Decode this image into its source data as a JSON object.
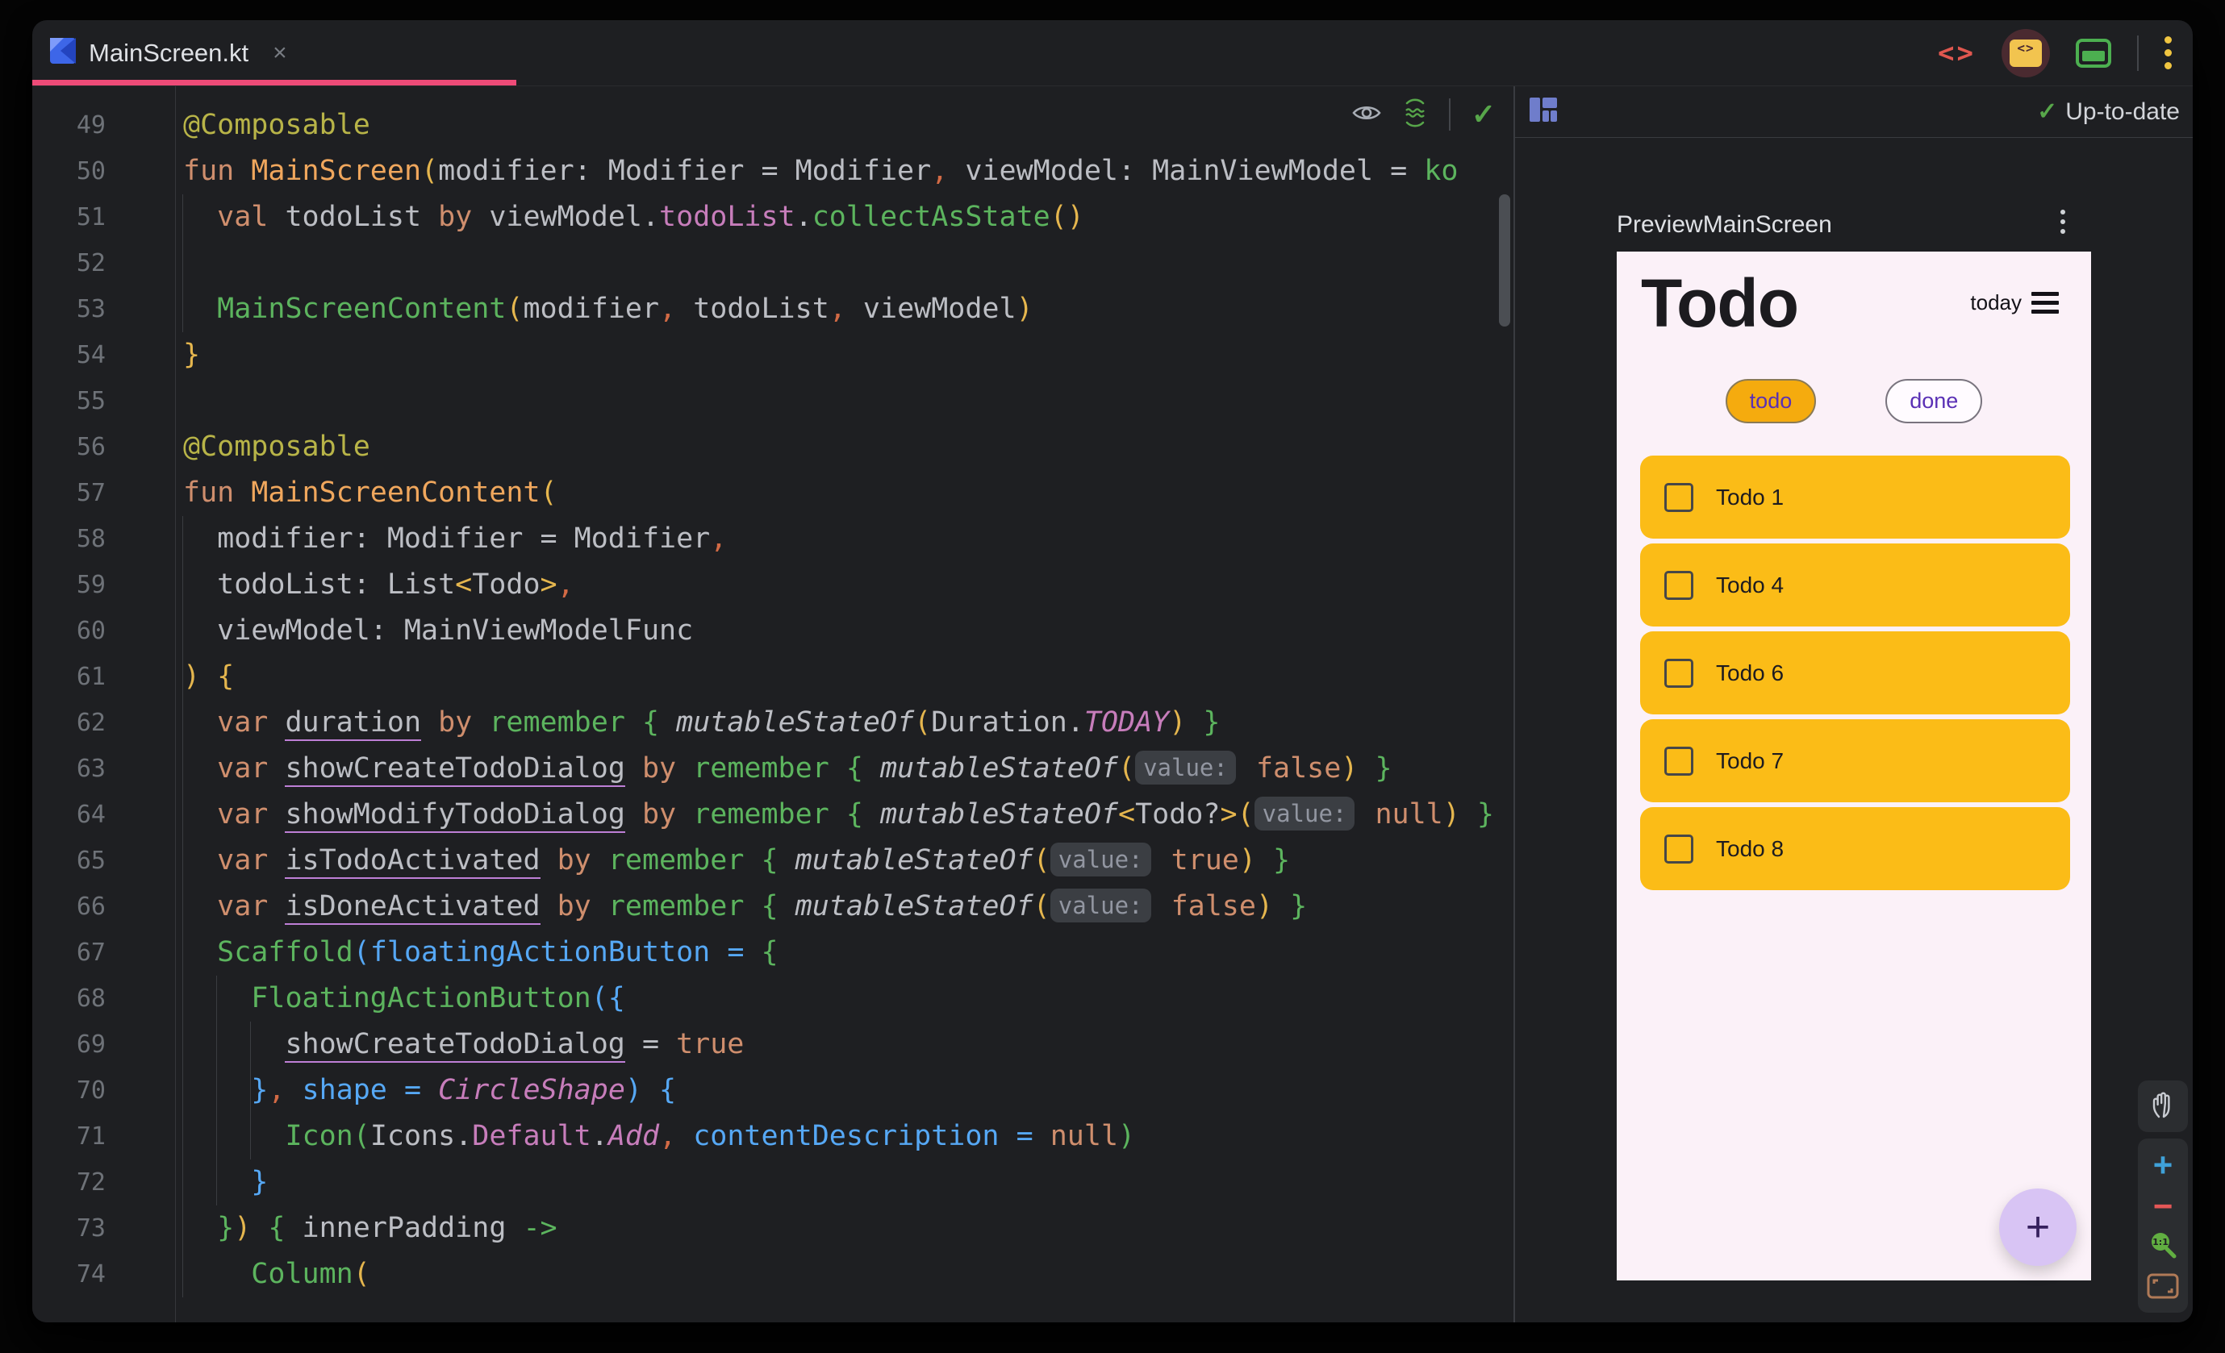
{
  "window": {
    "tab": {
      "title": "MainScreen.kt",
      "close": "×"
    },
    "modes": {
      "code_glyph": "<>",
      "split_glyph": "<>"
    }
  },
  "colors": {
    "tab_accent": "#EE4B78",
    "window_bg": "#1E1F22",
    "status_green": "#57A64A",
    "card_amber": "#FBBC17",
    "pill_amber": "#F5AB0E",
    "fab_lavender": "#D8C4F4",
    "purple_text": "#5A30B5",
    "phone_bg": "#FBF1F8"
  },
  "editor": {
    "overlay": {
      "check": "✓"
    },
    "lines": [
      {
        "n": "49",
        "t": [
          [
            "a",
            "@Composable"
          ]
        ]
      },
      {
        "n": "50",
        "t": [
          [
            "k",
            "fun "
          ],
          [
            "f",
            "MainScreen"
          ],
          [
            "y",
            "("
          ],
          [
            "d",
            "modifier: Modifier = Modifier"
          ],
          [
            "c",
            ","
          ],
          [
            "d",
            " viewModel: MainViewModel = "
          ],
          [
            "g",
            "ko"
          ]
        ]
      },
      {
        "n": "51",
        "t": [
          [
            "d",
            "  "
          ],
          [
            "k",
            "val "
          ],
          [
            "d",
            "todoList "
          ],
          [
            "k",
            "by "
          ],
          [
            "d",
            "viewModel."
          ],
          [
            "p",
            "todoList"
          ],
          [
            "d",
            "."
          ],
          [
            "g",
            "collectAsState"
          ],
          [
            "y",
            "()"
          ]
        ]
      },
      {
        "n": "52",
        "t": []
      },
      {
        "n": "53",
        "t": [
          [
            "d",
            "  "
          ],
          [
            "g",
            "MainScreenContent"
          ],
          [
            "y",
            "("
          ],
          [
            "d",
            "modifier"
          ],
          [
            "c",
            ","
          ],
          [
            "d",
            " todoList"
          ],
          [
            "c",
            ","
          ],
          [
            "d",
            " viewModel"
          ],
          [
            "y",
            ")"
          ]
        ]
      },
      {
        "n": "54",
        "t": [
          [
            "y",
            "}"
          ]
        ]
      },
      {
        "n": "55",
        "t": []
      },
      {
        "n": "56",
        "t": [
          [
            "a",
            "@Composable"
          ]
        ]
      },
      {
        "n": "57",
        "t": [
          [
            "k",
            "fun "
          ],
          [
            "f",
            "MainScreenContent"
          ],
          [
            "y",
            "("
          ]
        ]
      },
      {
        "n": "58",
        "t": [
          [
            "d",
            "  modifier: Modifier = Modifier"
          ],
          [
            "c",
            ","
          ]
        ]
      },
      {
        "n": "59",
        "t": [
          [
            "d",
            "  todoList: List"
          ],
          [
            "y",
            "<"
          ],
          [
            "d",
            "Todo"
          ],
          [
            "y",
            ">"
          ],
          [
            "c",
            ","
          ]
        ]
      },
      {
        "n": "60",
        "t": [
          [
            "d",
            "  viewModel: MainViewModelFunc"
          ]
        ]
      },
      {
        "n": "61",
        "t": [
          [
            "y",
            ") {"
          ]
        ]
      },
      {
        "n": "62",
        "t": [
          [
            "d",
            "  "
          ],
          [
            "k",
            "var "
          ],
          [
            "u",
            "duration"
          ],
          [
            "k",
            " by "
          ],
          [
            "g",
            "remember"
          ],
          [
            "d",
            " "
          ],
          [
            "g",
            "{"
          ],
          [
            "d",
            " "
          ],
          [
            "i",
            "mutableStateOf"
          ],
          [
            "y",
            "("
          ],
          [
            "d",
            "Duration."
          ],
          [
            "pi",
            "TODAY"
          ],
          [
            "y",
            ")"
          ],
          [
            "d",
            " "
          ],
          [
            "g",
            "}"
          ]
        ]
      },
      {
        "n": "63",
        "t": [
          [
            "d",
            "  "
          ],
          [
            "k",
            "var "
          ],
          [
            "u",
            "showCreateTodoDialog"
          ],
          [
            "k",
            " by "
          ],
          [
            "g",
            "remember"
          ],
          [
            "d",
            " "
          ],
          [
            "g",
            "{"
          ],
          [
            "d",
            " "
          ],
          [
            "i",
            "mutableStateOf"
          ],
          [
            "y",
            "("
          ],
          [
            "h",
            "value:"
          ],
          [
            "d",
            " "
          ],
          [
            "k",
            "false"
          ],
          [
            "y",
            ")"
          ],
          [
            "d",
            " "
          ],
          [
            "g",
            "}"
          ]
        ]
      },
      {
        "n": "64",
        "t": [
          [
            "d",
            "  "
          ],
          [
            "k",
            "var "
          ],
          [
            "u",
            "showModifyTodoDialog"
          ],
          [
            "k",
            " by "
          ],
          [
            "g",
            "remember"
          ],
          [
            "d",
            " "
          ],
          [
            "g",
            "{"
          ],
          [
            "d",
            " "
          ],
          [
            "i",
            "mutableStateOf"
          ],
          [
            "y",
            "<"
          ],
          [
            "d",
            "Todo?"
          ],
          [
            "y",
            ">("
          ],
          [
            "h",
            "value:"
          ],
          [
            "d",
            " "
          ],
          [
            "k",
            "null"
          ],
          [
            "y",
            ")"
          ],
          [
            "d",
            " "
          ],
          [
            "g",
            "}"
          ]
        ]
      },
      {
        "n": "65",
        "t": [
          [
            "d",
            "  "
          ],
          [
            "k",
            "var "
          ],
          [
            "u",
            "isTodoActivated"
          ],
          [
            "k",
            " by "
          ],
          [
            "g",
            "remember"
          ],
          [
            "d",
            " "
          ],
          [
            "g",
            "{"
          ],
          [
            "d",
            " "
          ],
          [
            "i",
            "mutableStateOf"
          ],
          [
            "y",
            "("
          ],
          [
            "h",
            "value:"
          ],
          [
            "d",
            " "
          ],
          [
            "k",
            "true"
          ],
          [
            "y",
            ")"
          ],
          [
            "d",
            " "
          ],
          [
            "g",
            "}"
          ]
        ]
      },
      {
        "n": "66",
        "t": [
          [
            "d",
            "  "
          ],
          [
            "k",
            "var "
          ],
          [
            "u",
            "isDoneActivated"
          ],
          [
            "k",
            " by "
          ],
          [
            "g",
            "remember"
          ],
          [
            "d",
            " "
          ],
          [
            "g",
            "{"
          ],
          [
            "d",
            " "
          ],
          [
            "i",
            "mutableStateOf"
          ],
          [
            "y",
            "("
          ],
          [
            "h",
            "value:"
          ],
          [
            "d",
            " "
          ],
          [
            "k",
            "false"
          ],
          [
            "y",
            ")"
          ],
          [
            "d",
            " "
          ],
          [
            "g",
            "}"
          ]
        ]
      },
      {
        "n": "67",
        "t": [
          [
            "d",
            "  "
          ],
          [
            "g",
            "Scaffold"
          ],
          [
            "b",
            "("
          ],
          [
            "b",
            "floatingActionButton"
          ],
          [
            "b",
            " = "
          ],
          [
            "g",
            "{"
          ]
        ]
      },
      {
        "n": "68",
        "t": [
          [
            "d",
            "    "
          ],
          [
            "g",
            "FloatingActionButton"
          ],
          [
            "b",
            "({"
          ]
        ]
      },
      {
        "n": "69",
        "t": [
          [
            "d",
            "      "
          ],
          [
            "u",
            "showCreateTodoDialog"
          ],
          [
            "d",
            " = "
          ],
          [
            "k",
            "true"
          ]
        ]
      },
      {
        "n": "70",
        "t": [
          [
            "d",
            "    "
          ],
          [
            "b",
            "}"
          ],
          [
            "c",
            ","
          ],
          [
            "b",
            " shape"
          ],
          [
            "b",
            " = "
          ],
          [
            "pi",
            "CircleShape"
          ],
          [
            "b",
            ") {"
          ]
        ]
      },
      {
        "n": "71",
        "t": [
          [
            "d",
            "      "
          ],
          [
            "g",
            "Icon"
          ],
          [
            "g",
            "("
          ],
          [
            "d",
            "Icons."
          ],
          [
            "p",
            "Default"
          ],
          [
            "d",
            "."
          ],
          [
            "pi",
            "Add"
          ],
          [
            "c",
            ","
          ],
          [
            "b",
            " contentDescription"
          ],
          [
            "b",
            " = "
          ],
          [
            "k",
            "null"
          ],
          [
            "g",
            ")"
          ]
        ]
      },
      {
        "n": "72",
        "t": [
          [
            "d",
            "    "
          ],
          [
            "b",
            "}"
          ]
        ]
      },
      {
        "n": "73",
        "t": [
          [
            "d",
            "  "
          ],
          [
            "g",
            "}"
          ],
          [
            "y",
            ")"
          ],
          [
            "d",
            " "
          ],
          [
            "g",
            "{"
          ],
          [
            "d",
            " innerPadding "
          ],
          [
            "g",
            "->"
          ]
        ]
      },
      {
        "n": "74",
        "t": [
          [
            "d",
            "    "
          ],
          [
            "g",
            "Column"
          ],
          [
            "y",
            "("
          ]
        ]
      }
    ]
  },
  "preview": {
    "toolbar": {
      "check": "✓",
      "status": "Up-to-date"
    },
    "title": "PreviewMainScreen",
    "phone": {
      "app_title": "Todo",
      "menu_label": "today",
      "filters": [
        {
          "label": "todo",
          "active": true
        },
        {
          "label": "done",
          "active": false
        }
      ],
      "todos": [
        "Todo 1",
        "Todo 4",
        "Todo 6",
        "Todo 7",
        "Todo 8"
      ],
      "fab": "+"
    },
    "zoom_controls": {
      "zoom_in": "+",
      "zoom_out": "−",
      "zoom_100": "1:1"
    }
  }
}
